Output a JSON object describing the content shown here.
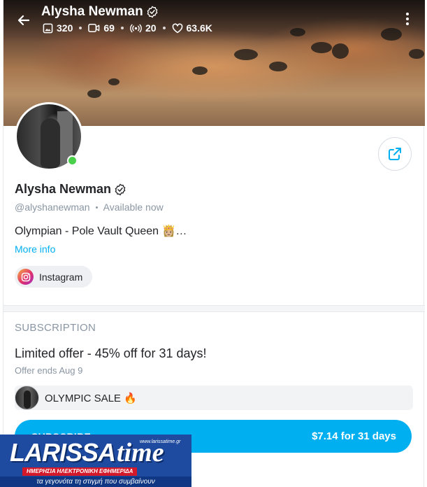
{
  "header": {
    "name": "Alysha Newman",
    "stats": {
      "photos": "320",
      "videos": "69",
      "streams": "20",
      "likes": "63.6K"
    }
  },
  "profile": {
    "name": "Alysha Newman",
    "handle": "@alyshanewman",
    "status": "Available now",
    "bio": "Olympian - Pole Vault Queen 👸🏼…",
    "more_info": "More info",
    "social_label": "Instagram"
  },
  "subscription": {
    "heading": "SUBSCRIPTION",
    "offer_title": "Limited offer - 45% off for 31 days!",
    "offer_ends": "Offer ends Aug 9",
    "promo_label": "OLYMPIC SALE 🔥",
    "button_label": "SUBSCRIBE",
    "button_price": "$7.14 for 31 days"
  },
  "watermark": {
    "brand_first": "LARISSA",
    "brand_second": "time",
    "url": "www.larissatime.gr",
    "tagline_top": "ΗΜΕΡΗΣΙΑ ΗΛΕΚΤΡΟΝΙΚΗ ΕΦΗΜΕΡΙΔΑ",
    "tagline_bottom": "τα γεγονότα τη στιγμή που συμβαίνουν"
  },
  "colors": {
    "accent": "#00aff0",
    "online": "#4bd04b",
    "muted": "#8a96a3",
    "watermark_blue": "#1e4aa0",
    "watermark_red": "#d3182a"
  },
  "icons": [
    "back-arrow-icon",
    "verified-icon",
    "photo-icon",
    "video-icon",
    "stream-icon",
    "heart-icon",
    "kebab-menu-icon",
    "share-icon",
    "instagram-icon"
  ]
}
